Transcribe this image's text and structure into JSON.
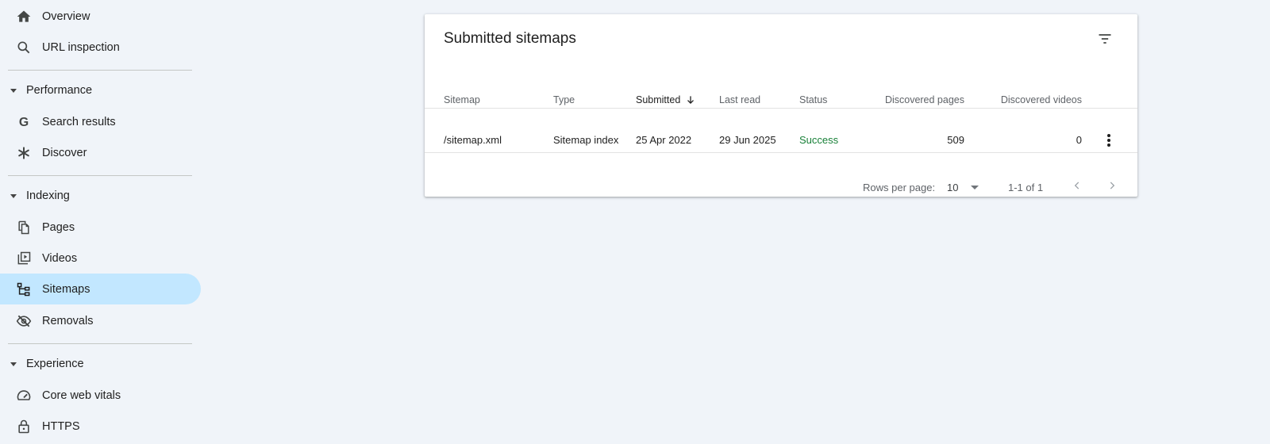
{
  "sidebar": {
    "top_items": [
      {
        "label": "Overview",
        "icon": "home-icon"
      },
      {
        "label": "URL inspection",
        "icon": "search-icon"
      }
    ],
    "sections": [
      {
        "label": "Performance",
        "items": [
          {
            "label": "Search results",
            "icon": "google-g-icon"
          },
          {
            "label": "Discover",
            "icon": "asterisk-icon"
          }
        ]
      },
      {
        "label": "Indexing",
        "items": [
          {
            "label": "Pages",
            "icon": "pages-icon"
          },
          {
            "label": "Videos",
            "icon": "video-icon"
          },
          {
            "label": "Sitemaps",
            "icon": "sitemap-icon",
            "active": true
          },
          {
            "label": "Removals",
            "icon": "eye-off-icon"
          }
        ]
      },
      {
        "label": "Experience",
        "items": [
          {
            "label": "Core web vitals",
            "icon": "speedometer-icon"
          },
          {
            "label": "HTTPS",
            "icon": "lock-icon"
          }
        ]
      }
    ]
  },
  "card": {
    "title": "Submitted sitemaps",
    "columns": {
      "sitemap": "Sitemap",
      "type": "Type",
      "submitted": "Submitted",
      "last_read": "Last read",
      "status": "Status",
      "discovered_pages": "Discovered pages",
      "discovered_videos": "Discovered videos"
    },
    "rows": [
      {
        "sitemap": "/sitemap.xml",
        "type": "Sitemap index",
        "submitted": "25 Apr 2022",
        "last_read": "29 Jun 2025",
        "status": "Success",
        "discovered_pages": "509",
        "discovered_videos": "0"
      }
    ],
    "footer": {
      "rows_per_page_label": "Rows per page:",
      "rows_per_page_value": "10",
      "range": "1-1 of 1"
    }
  },
  "colors": {
    "background": "#f0f4f9",
    "active_nav": "#c2e7ff",
    "success": "#188038"
  }
}
